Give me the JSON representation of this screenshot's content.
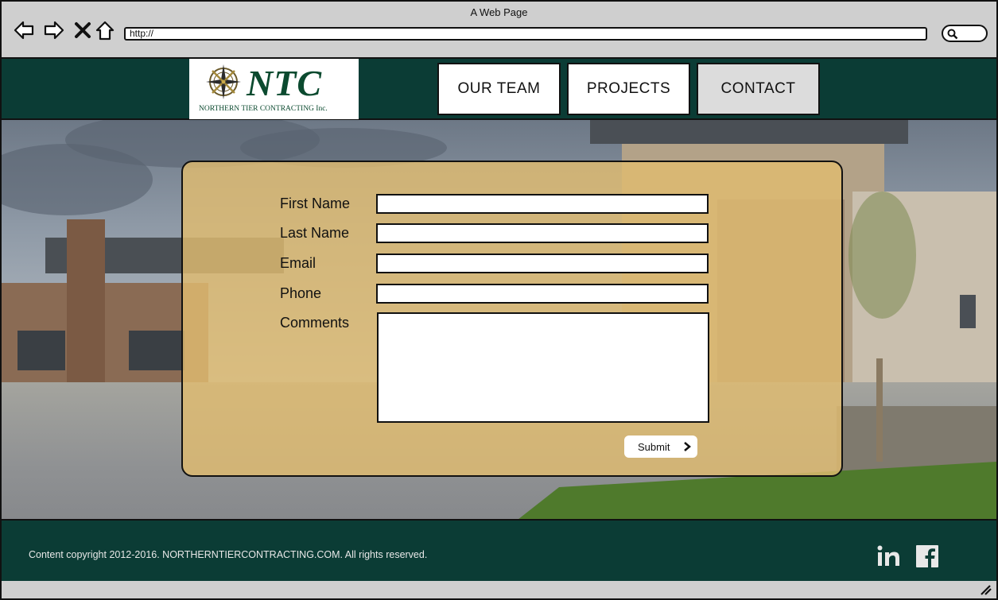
{
  "browser": {
    "window_title": "A Web Page",
    "url": "http://"
  },
  "header": {
    "logo": {
      "main": "NTC",
      "sub": "NORTHERN TIER CONTRACTING  Inc."
    },
    "nav": [
      {
        "label": "OUR TEAM",
        "active": false
      },
      {
        "label": "PROJECTS",
        "active": false
      },
      {
        "label": "CONTACT",
        "active": true
      }
    ]
  },
  "form": {
    "fields": [
      {
        "label": "First Name",
        "value": ""
      },
      {
        "label": "Last Name",
        "value": ""
      },
      {
        "label": "Email",
        "value": ""
      },
      {
        "label": "Phone",
        "value": ""
      }
    ],
    "comments": {
      "label": "Comments",
      "value": ""
    },
    "submit_label": "Submit"
  },
  "footer": {
    "copyright": "Content copyright 2012-2016. NORTHERNTIERCONTRACTING.COM. All rights reserved.",
    "social": [
      "linkedin-icon",
      "facebook-icon"
    ]
  },
  "colors": {
    "header_bg": "#0b3c35",
    "panel_bg": "#e0bc70",
    "logo_green": "#0b4a2f"
  }
}
